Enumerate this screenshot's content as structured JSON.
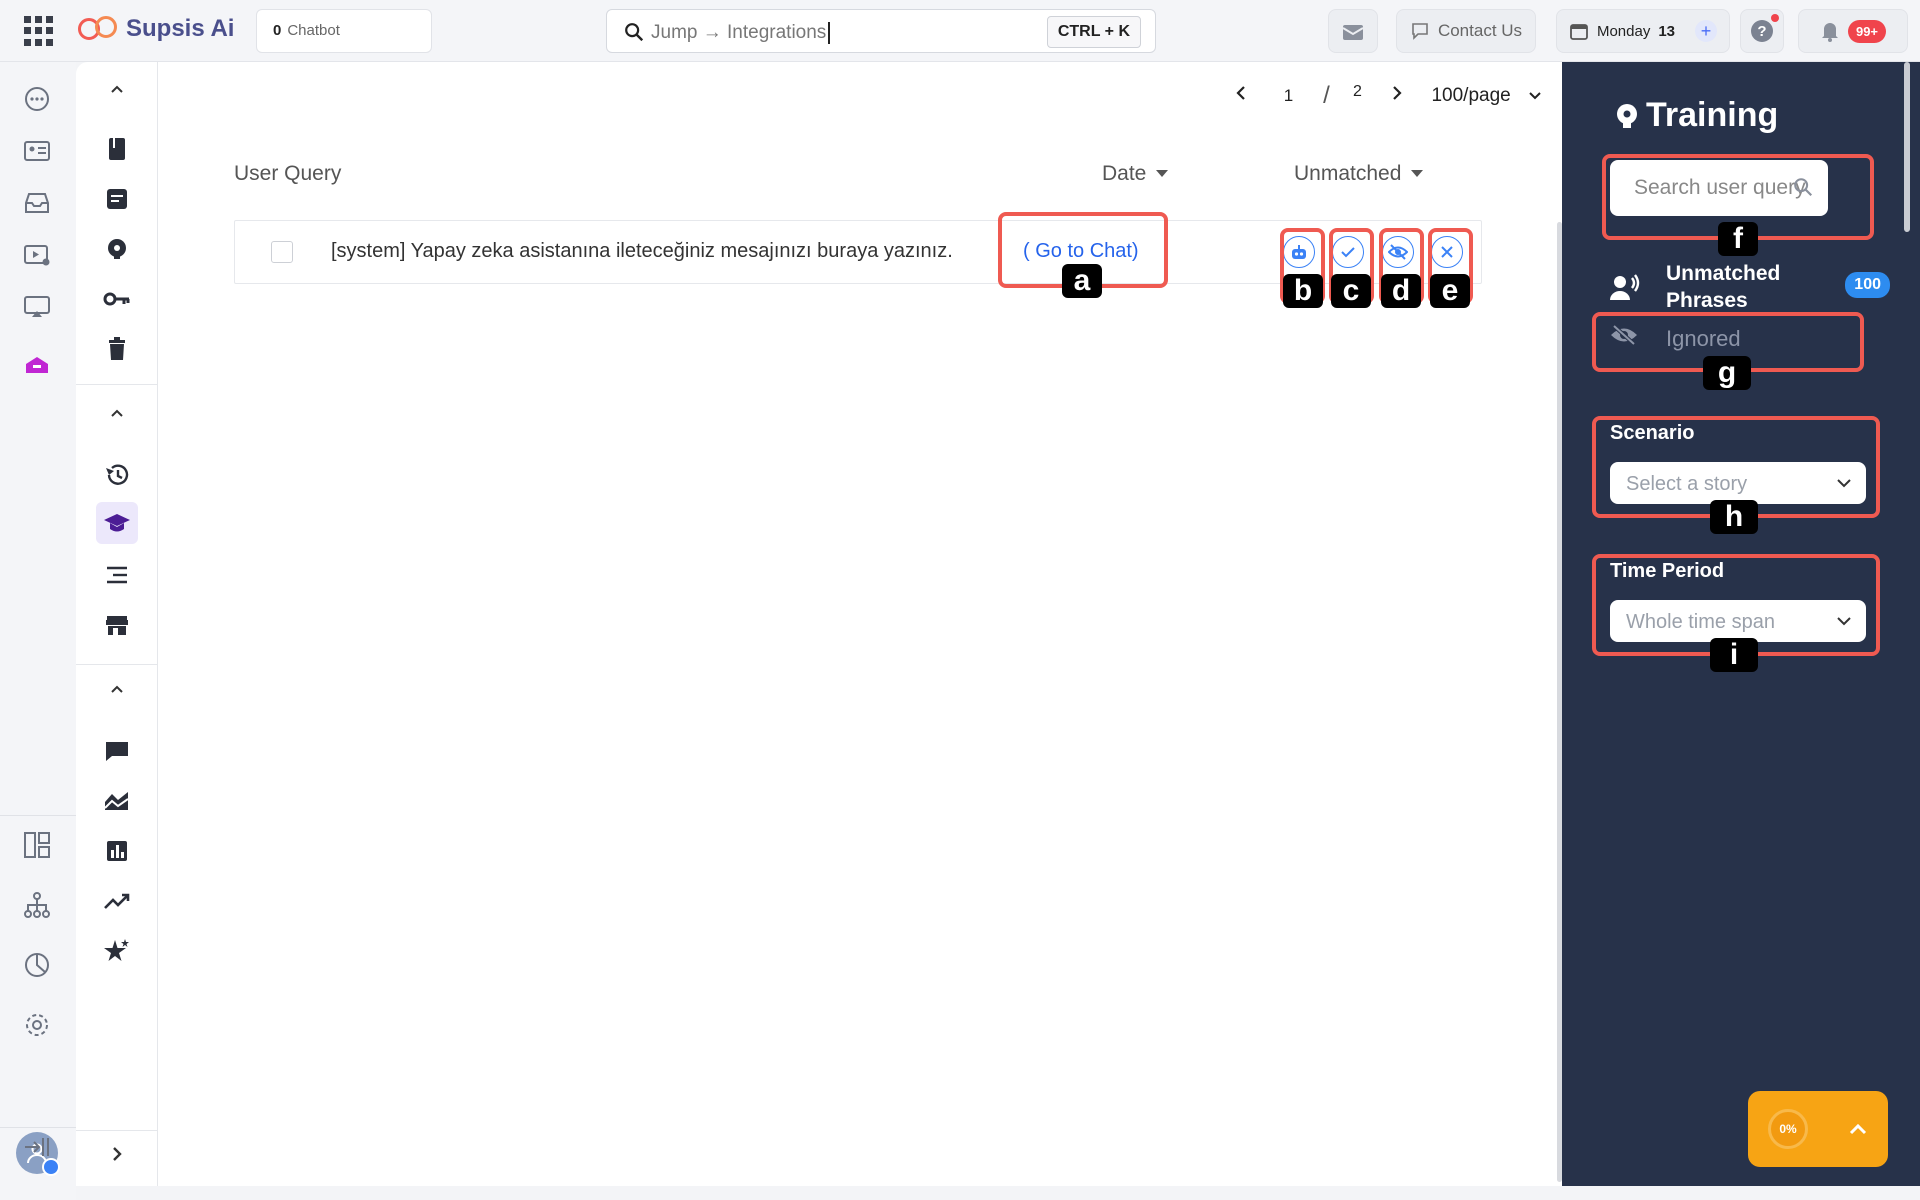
{
  "app": {
    "name": "Supsis Ai"
  },
  "topbar": {
    "chatbot_count": "0",
    "chatbot_label": "Chatbot",
    "search_value": "Jump → Integrations",
    "shortcut": "CTRL + K",
    "contact_label": "Contact Us",
    "day_label": "Monday",
    "day_number": "13",
    "notif_badge": "99+"
  },
  "pagination": {
    "current": "1",
    "separator": "/",
    "total": "2",
    "per_page": "100/page"
  },
  "table": {
    "columns": {
      "query": "User Query",
      "date": "Date",
      "status": "Unmatched"
    },
    "rows": [
      {
        "query": "[system] Yapay zeka asistanına ileteceğiniz mesajınızı buraya yazınız.",
        "link": "( Go to Chat)"
      }
    ]
  },
  "annotations": {
    "a": "a",
    "b": "b",
    "c": "c",
    "d": "d",
    "e": "e",
    "f": "f",
    "g": "g",
    "h": "h",
    "i": "i"
  },
  "panel": {
    "title": "Training",
    "search_placeholder": "Search user query",
    "unmatched_label": "Unmatched Phrases",
    "unmatched_count": "100",
    "ignored_label": "Ignored",
    "scenario_label": "Scenario",
    "scenario_value": "Select a story",
    "period_label": "Time Period",
    "period_value": "Whole time span"
  },
  "progress": {
    "percent": "0%"
  },
  "colors": {
    "accent": "#2563eb",
    "panel": "#27324a",
    "annotation": "#ef5a51",
    "brand": "#4a4f8c"
  }
}
